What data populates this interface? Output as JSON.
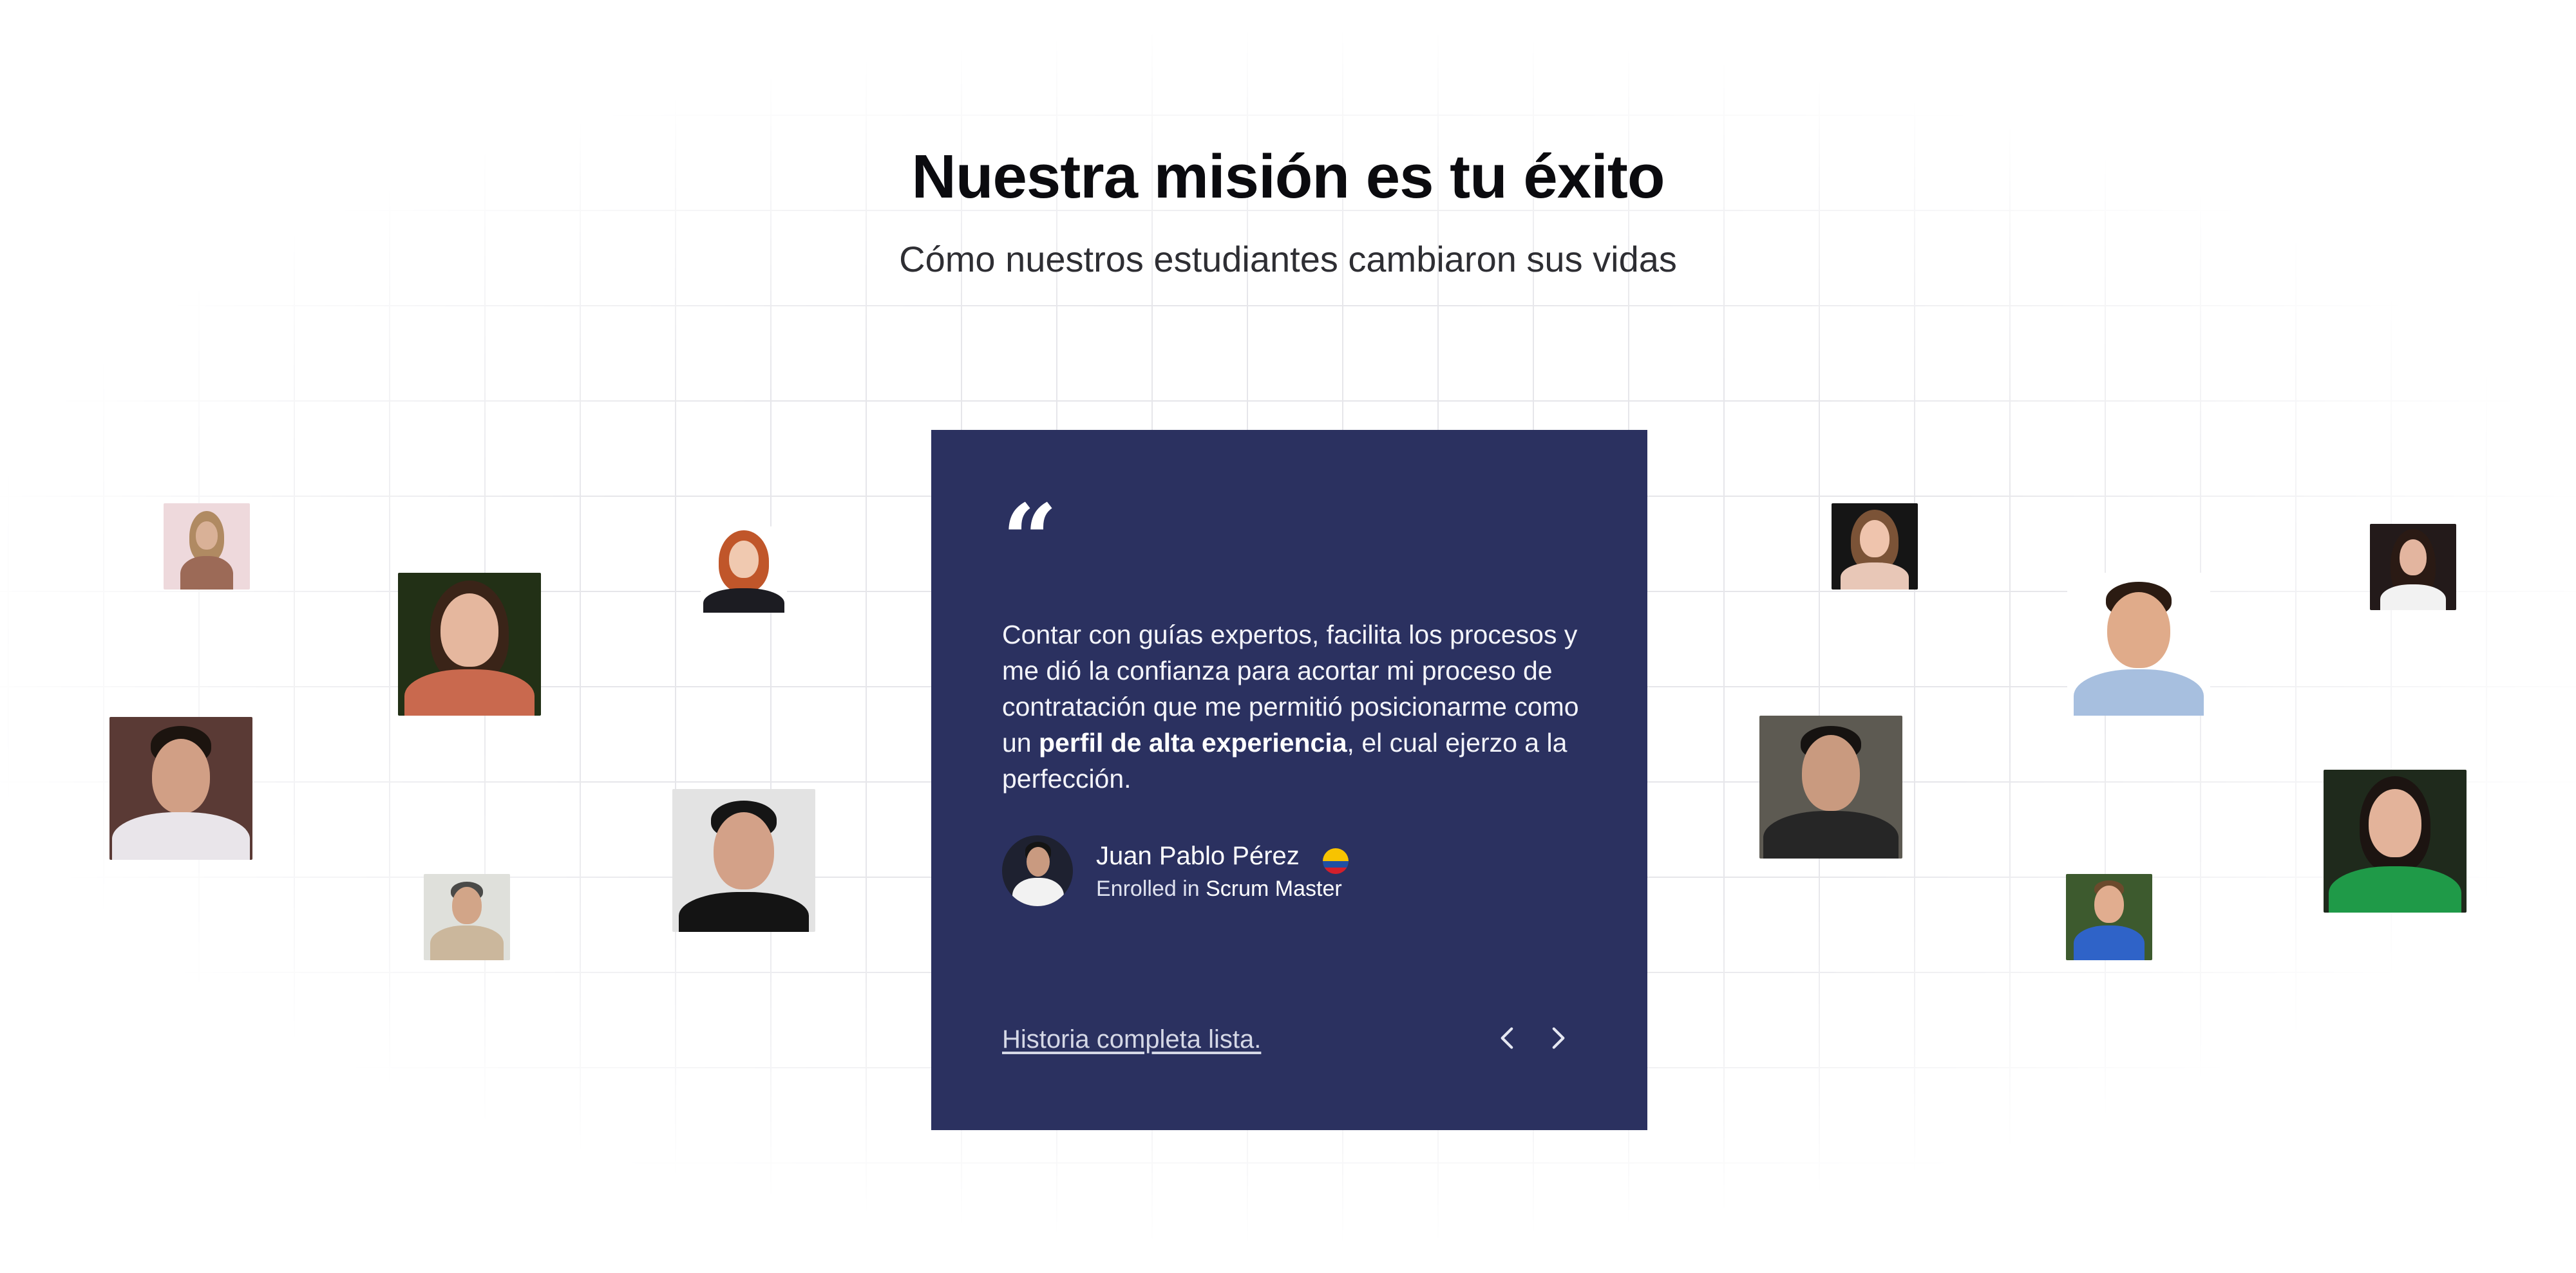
{
  "section": {
    "title": "Nuestra misión es tu éxito",
    "subtitle": "Cómo nuestros estudiantes cambiaron sus vidas"
  },
  "testimonial": {
    "quote_mark": "“",
    "quote_part1": "Contar con guías expertos, facilita los procesos y me dió la confianza para acortar mi proceso de contratación que me permitió posicionarme como un ",
    "quote_bold": "perfil de alta experiencia",
    "quote_part2": ", el cual ejerzo a la perfección.",
    "author_name": "Juan Pablo Pérez",
    "author_flag_icon": "colombia-flag-icon",
    "enrolled_prefix": "Enrolled in ",
    "course": "Scrum Master",
    "story_link": "Historia completa lista.",
    "prev_icon": "chevron-left-icon",
    "next_icon": "chevron-right-icon"
  },
  "colors": {
    "card_background": "#2b3160",
    "heading": "#0b0b0f",
    "grid_lines": "#e6e6ea"
  }
}
